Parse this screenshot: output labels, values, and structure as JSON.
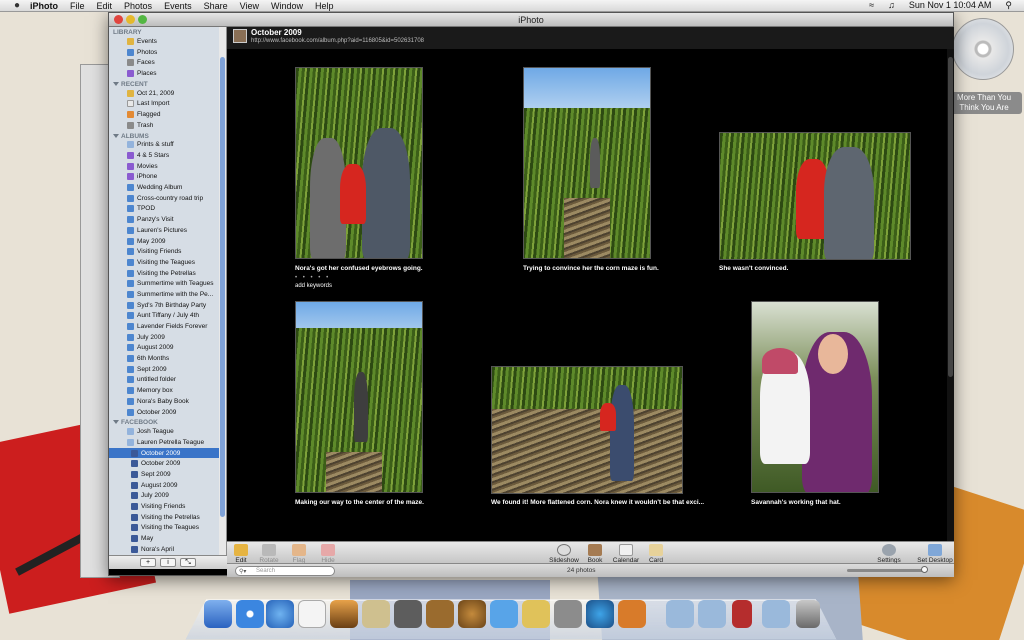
{
  "menubar": {
    "apple": "",
    "app": "iPhoto",
    "menus": [
      "File",
      "Edit",
      "Photos",
      "Events",
      "Share",
      "View",
      "Window",
      "Help"
    ],
    "clock": "Sun Nov 1  10:04 AM"
  },
  "desktop": {
    "cd_label": "More Than You Think You Are"
  },
  "window": {
    "title": "iPhoto"
  },
  "sidebar": {
    "sections": {
      "library": "LIBRARY",
      "recent": "RECENT",
      "albums": "ALBUMS",
      "facebook": "FACEBOOK"
    },
    "library": [
      "Events",
      "Photos",
      "Faces",
      "Places"
    ],
    "recent": [
      "Oct 21, 2009",
      "Last Import",
      "Flagged",
      "Trash"
    ],
    "albums": [
      "Prints & stuff",
      "4 & 5 Stars",
      "Movies",
      "iPhone",
      "Wedding Album",
      "Cross-country road trip",
      "TPOD",
      "Panzy's Visit",
      "Lauren's Pictures",
      "May 2009",
      "Visiting Friends",
      "Visiting the Teagues",
      "Visiting the Petrellas",
      "Summertime with Teagues",
      "Summertime with the Pe...",
      "Syd's 7th Birthday Party",
      "Aunt Tiffany / July 4th",
      "Lavender Fields Forever",
      "July 2009",
      "August 2009",
      "6th Months",
      "Sept 2009",
      "untitled folder",
      "Memory box",
      "Nora's Baby Book",
      "October 2009"
    ],
    "facebook": [
      "Josh Teague",
      "Lauren Petrella Teague"
    ],
    "facebook_albums": [
      "October 2009",
      "October 2009",
      "Sept 2009",
      "August 2009",
      "July 2009",
      "Visiting Friends",
      "Visiting the Petrellas",
      "Visiting the Teagues",
      "May",
      "Nora's April"
    ],
    "footer": {
      "add": "+",
      "info": "i",
      "expand": "⤡"
    }
  },
  "header": {
    "title": "October 2009",
    "url": "http://www.facebook.com/album.php?aid=116805&id=502631708"
  },
  "photos": [
    {
      "caption": "Nora's got her confused eyebrows going.",
      "rating": "• • • • •",
      "keywords": "add keywords"
    },
    {
      "caption": "Trying to convince her the corn maze is fun."
    },
    {
      "caption": "She wasn't convinced."
    },
    {
      "caption": "Making our way to the center of the maze."
    },
    {
      "caption": "We found it! More flattened corn. Nora knew it wouldn't be that exci..."
    },
    {
      "caption": "Savannah's working that hat."
    }
  ],
  "toolbar": {
    "edit": "Edit",
    "rotate": "Rotate",
    "flag": "Flag",
    "hide": "Hide",
    "slideshow": "Slideshow",
    "book": "Book",
    "calendar": "Calendar",
    "card": "Card",
    "settings": "Settings",
    "set_desktop": "Set Desktop"
  },
  "status": {
    "search_placeholder": "Search",
    "count": "24 photos"
  }
}
